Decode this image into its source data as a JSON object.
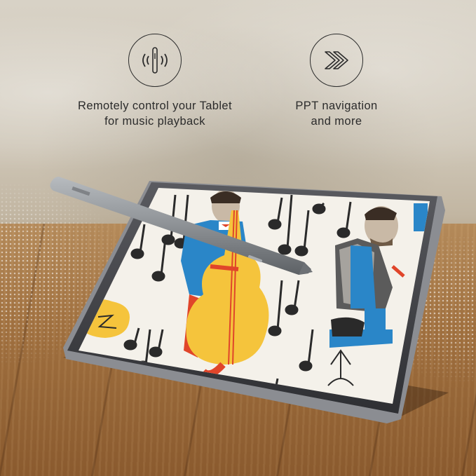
{
  "features": [
    {
      "icon": "pen-signal-icon",
      "line1": "Remotely control your Tablet",
      "line2": "for music playback"
    },
    {
      "icon": "fast-forward-icon",
      "line1": "PPT navigation",
      "line2": "and more"
    }
  ],
  "colors": {
    "text": "#2b2b2b",
    "tablet_frame": "#4a4a4f",
    "pen": "#8d9195",
    "illustration_yellow": "#f5c43c",
    "illustration_red": "#e0452a",
    "illustration_blue": "#2a86c8"
  }
}
